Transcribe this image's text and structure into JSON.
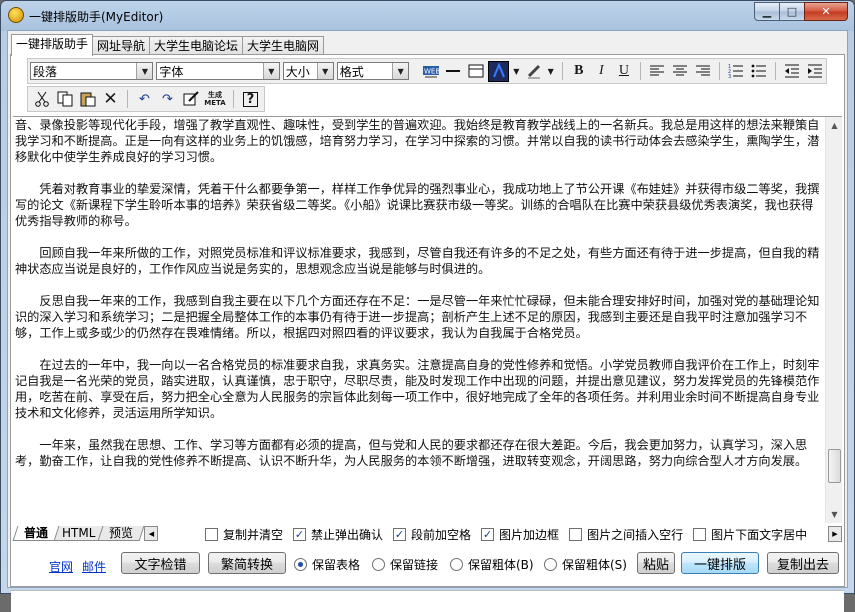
{
  "window": {
    "title": "一键排版助手(MyEditor)",
    "controls": {
      "minimize": "▁",
      "maximize": "□",
      "close": "✕"
    }
  },
  "tabs": [
    {
      "label": "一键排版助手",
      "active": true
    },
    {
      "label": "网址导航"
    },
    {
      "label": "大学生电脑论坛"
    },
    {
      "label": "大学生电脑网"
    }
  ],
  "toolbar": {
    "paragraph_combo": "段落",
    "font_combo": "字体",
    "size_combo": "大小",
    "format_combo": "格式",
    "bold": "B",
    "italic": "I",
    "underline": "U",
    "generate_meta": "生成META",
    "help": "?"
  },
  "editor": {
    "paragraphs": [
      {
        "text": "音、录像投影等现代化手段，增强了教学直观性、趣味性，受到学生的普遍欢迎。我始终是教育教学战线上的一名新兵。我总是用这样的想法来鞭策自我学习和不断提高。正是一向有这样的业务上的饥饿感，培育努力学习，在学习中探索的习惯。并常以自我的读书行动体会去感染学生，熏陶学生，潜移默化中使学生养成良好的学习习惯。",
        "continuation": true
      },
      {
        "text": "凭着对教育事业的挚爱深情，凭着干什么都要争第一，样样工作争优异的强烈事业心，我成功地上了节公开课《布娃娃》并获得市级二等奖，我撰写的论文《新课程下学生聆听本事的培养》荣获省级二等奖。《小船》说课比赛获市级一等奖。训练的合唱队在比赛中荣获县级优秀表演奖，我也获得优秀指导教师的称号。"
      },
      {
        "text": "回顾自我一年来所做的工作，对照党员标准和评议标准要求，我感到，尽管自我还有许多的不足之处，有些方面还有待于进一步提高，但自我的精神状态应当说是良好的，工作作风应当说是务实的，思想观念应当说是能够与时俱进的。"
      },
      {
        "text": "反思自我一年来的工作，我感到自我主要在以下几个方面还存在不足：一是尽管一年来忙忙碌碌，但未能合理安排好时间，加强对党的基础理论知识的深入学习和系统学习；二是把握全局整体工作的本事仍有待于进一步提高；剖析产生上述不足的原因，我感到主要还是自我平时注意加强学习不够，工作上或多或少的仍然存在畏难情绪。所以，根据四对照四看的评议要求，我认为自我属于合格党员。"
      },
      {
        "text": "在过去的一年中，我一向以一名合格党员的标准要求自我，求真务实。注意提高自身的党性修养和觉悟。小学党员教师自我评价在工作上，时刻牢记自我是一名光荣的党员，踏实进取，认真谨慎，忠于职守，尽职尽责，能及时发现工作中出现的问题，并提出意见建议，努力发挥党员的先锋模范作用，吃苦在前、享受在后，努力把全心全意为人民服务的宗旨体此刻每一项工作中，很好地完成了全年的各项任务。并利用业余时间不断提高自身专业技术和文化修养，灵活运用所学知识。"
      },
      {
        "text": "一年来，虽然我在思想、工作、学习等方面都有必须的提高，但与党和人民的要求都还存在很大差距。今后，我会更加努力，认真学习，深入思考，勤奋工作，让自我的党性修养不断提高、认识不断升华，为人民服务的本领不断增强，进取转变观念，开阔思路，努力向综合型人才方向发展。"
      }
    ]
  },
  "mode_tabs": [
    {
      "label": "普通",
      "active": true
    },
    {
      "label": "HTML"
    },
    {
      "label": "预览"
    }
  ],
  "options": [
    {
      "label": "复制并清空",
      "checked": false
    },
    {
      "label": "禁止弹出确认",
      "checked": true
    },
    {
      "label": "段前加空格",
      "checked": true
    },
    {
      "label": "图片加边框",
      "checked": true
    },
    {
      "label": "图片之间插入空行",
      "checked": false
    },
    {
      "label": "图片下面文字居中",
      "checked": false
    }
  ],
  "actions": {
    "link_official": "官网",
    "link_mail": "邮件",
    "text_check": "文字检错",
    "convert": "繁简转换",
    "radios": [
      {
        "label": "保留表格",
        "selected": true
      },
      {
        "label": "保留链接",
        "selected": false
      },
      {
        "label": "保留粗体(B)",
        "selected": false
      },
      {
        "label": "保留粗体(S)",
        "selected": false
      }
    ],
    "paste": "粘贴",
    "one_click": "一键排版",
    "copy_out": "复制出去"
  },
  "colors": {
    "accent": "#3c7fb1",
    "link": "#0033cc",
    "close": "#c23a1f"
  }
}
